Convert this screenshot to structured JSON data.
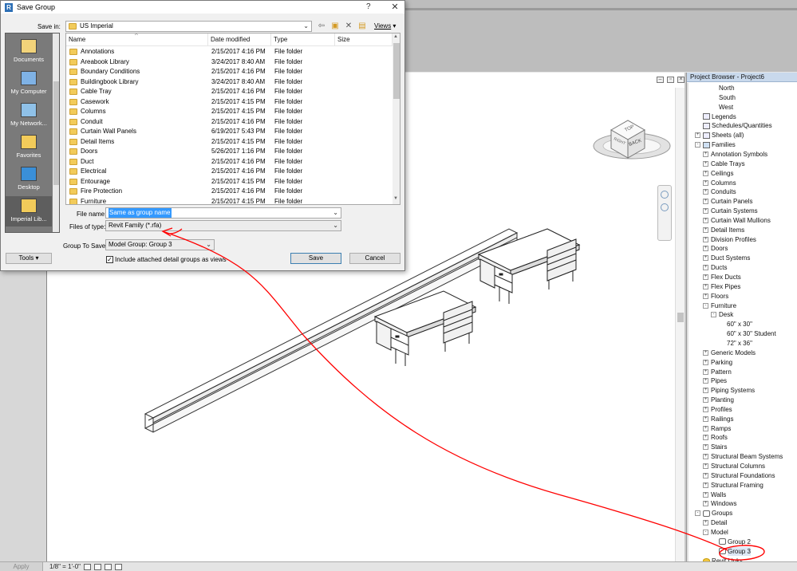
{
  "dialog": {
    "title": "Save Group",
    "app_icon": "R",
    "help_glyph": "?",
    "close_glyph": "✕",
    "save_in_label": "Save in:",
    "save_in_value": "US Imperial",
    "views_label": "Views",
    "columns": {
      "name": "Name",
      "date": "Date modified",
      "type": "Type",
      "size": "Size"
    },
    "files": [
      {
        "name": "Annotations",
        "date": "2/15/2017 4:16 PM",
        "type": "File folder"
      },
      {
        "name": "Areabook Library",
        "date": "3/24/2017 8:40 AM",
        "type": "File folder"
      },
      {
        "name": "Boundary Conditions",
        "date": "2/15/2017 4:16 PM",
        "type": "File folder"
      },
      {
        "name": "Buildingbook Library",
        "date": "3/24/2017 8:40 AM",
        "type": "File folder"
      },
      {
        "name": "Cable Tray",
        "date": "2/15/2017 4:16 PM",
        "type": "File folder"
      },
      {
        "name": "Casework",
        "date": "2/15/2017 4:15 PM",
        "type": "File folder"
      },
      {
        "name": "Columns",
        "date": "2/15/2017 4:15 PM",
        "type": "File folder"
      },
      {
        "name": "Conduit",
        "date": "2/15/2017 4:16 PM",
        "type": "File folder"
      },
      {
        "name": "Curtain Wall Panels",
        "date": "6/19/2017 5:43 PM",
        "type": "File folder"
      },
      {
        "name": "Detail Items",
        "date": "2/15/2017 4:15 PM",
        "type": "File folder"
      },
      {
        "name": "Doors",
        "date": "5/26/2017 1:16 PM",
        "type": "File folder"
      },
      {
        "name": "Duct",
        "date": "2/15/2017 4:16 PM",
        "type": "File folder"
      },
      {
        "name": "Electrical",
        "date": "2/15/2017 4:16 PM",
        "type": "File folder"
      },
      {
        "name": "Entourage",
        "date": "2/15/2017 4:15 PM",
        "type": "File folder"
      },
      {
        "name": "Fire Protection",
        "date": "2/15/2017 4:16 PM",
        "type": "File folder"
      },
      {
        "name": "Furniture",
        "date": "2/15/2017 4:15 PM",
        "type": "File folder"
      }
    ],
    "places": [
      {
        "label": "Documents"
      },
      {
        "label": "My Computer"
      },
      {
        "label": "My Network..."
      },
      {
        "label": "Favorites"
      },
      {
        "label": "Desktop"
      },
      {
        "label": "Imperial Lib..."
      }
    ],
    "file_name_label": "File name:",
    "file_name_value": "Same as group name",
    "files_of_type_label": "Files of type:",
    "files_of_type_value": "Revit Family  (*.rfa)",
    "group_to_save_label": "Group To Save:",
    "group_to_save_value": "Model Group: Group 3",
    "include_detail_label": "Include attached detail groups as views",
    "include_detail_checked": true,
    "tools_label": "Tools",
    "save_label": "Save",
    "cancel_label": "Cancel"
  },
  "project_browser": {
    "title": "Project Browser - Project6",
    "items": [
      {
        "label": "North",
        "indent": 3,
        "icon": "none"
      },
      {
        "label": "South",
        "indent": 3,
        "icon": "none"
      },
      {
        "label": "West",
        "indent": 3,
        "icon": "none"
      },
      {
        "label": "Legends",
        "indent": 1,
        "icon": "legend-icon"
      },
      {
        "label": "Schedules/Quantities",
        "indent": 1,
        "icon": "schedule-icon"
      },
      {
        "label": "Sheets (all)",
        "indent": 1,
        "icon": "sheet-icon",
        "expander": "+"
      },
      {
        "label": "Families",
        "indent": 1,
        "icon": "families-icon",
        "expander": "-"
      },
      {
        "label": "Annotation Symbols",
        "indent": 2,
        "icon": "none",
        "expander": "+"
      },
      {
        "label": "Cable Trays",
        "indent": 2,
        "icon": "none",
        "expander": "+"
      },
      {
        "label": "Ceilings",
        "indent": 2,
        "icon": "none",
        "expander": "+"
      },
      {
        "label": "Columns",
        "indent": 2,
        "icon": "none",
        "expander": "+"
      },
      {
        "label": "Conduits",
        "indent": 2,
        "icon": "none",
        "expander": "+"
      },
      {
        "label": "Curtain Panels",
        "indent": 2,
        "icon": "none",
        "expander": "+"
      },
      {
        "label": "Curtain Systems",
        "indent": 2,
        "icon": "none",
        "expander": "+"
      },
      {
        "label": "Curtain Wall Mullions",
        "indent": 2,
        "icon": "none",
        "expander": "+"
      },
      {
        "label": "Detail Items",
        "indent": 2,
        "icon": "none",
        "expander": "+"
      },
      {
        "label": "Division Profiles",
        "indent": 2,
        "icon": "none",
        "expander": "+"
      },
      {
        "label": "Doors",
        "indent": 2,
        "icon": "none",
        "expander": "+"
      },
      {
        "label": "Duct Systems",
        "indent": 2,
        "icon": "none",
        "expander": "+"
      },
      {
        "label": "Ducts",
        "indent": 2,
        "icon": "none",
        "expander": "+"
      },
      {
        "label": "Flex Ducts",
        "indent": 2,
        "icon": "none",
        "expander": "+"
      },
      {
        "label": "Flex Pipes",
        "indent": 2,
        "icon": "none",
        "expander": "+"
      },
      {
        "label": "Floors",
        "indent": 2,
        "icon": "none",
        "expander": "+"
      },
      {
        "label": "Furniture",
        "indent": 2,
        "icon": "none",
        "expander": "-"
      },
      {
        "label": "Desk",
        "indent": 3,
        "icon": "none",
        "expander": "-"
      },
      {
        "label": "60\" x 30\"",
        "indent": 4,
        "icon": "none"
      },
      {
        "label": "60\" x 30\" Student",
        "indent": 4,
        "icon": "none"
      },
      {
        "label": "72\" x 36\"",
        "indent": 4,
        "icon": "none"
      },
      {
        "label": "Generic Models",
        "indent": 2,
        "icon": "none",
        "expander": "+"
      },
      {
        "label": "Parking",
        "indent": 2,
        "icon": "none",
        "expander": "+"
      },
      {
        "label": "Pattern",
        "indent": 2,
        "icon": "none",
        "expander": "+"
      },
      {
        "label": "Pipes",
        "indent": 2,
        "icon": "none",
        "expander": "+"
      },
      {
        "label": "Piping Systems",
        "indent": 2,
        "icon": "none",
        "expander": "+"
      },
      {
        "label": "Planting",
        "indent": 2,
        "icon": "none",
        "expander": "+"
      },
      {
        "label": "Profiles",
        "indent": 2,
        "icon": "none",
        "expander": "+"
      },
      {
        "label": "Railings",
        "indent": 2,
        "icon": "none",
        "expander": "+"
      },
      {
        "label": "Ramps",
        "indent": 2,
        "icon": "none",
        "expander": "+"
      },
      {
        "label": "Roofs",
        "indent": 2,
        "icon": "none",
        "expander": "+"
      },
      {
        "label": "Stairs",
        "indent": 2,
        "icon": "none",
        "expander": "+"
      },
      {
        "label": "Structural Beam Systems",
        "indent": 2,
        "icon": "none",
        "expander": "+"
      },
      {
        "label": "Structural Columns",
        "indent": 2,
        "icon": "none",
        "expander": "+"
      },
      {
        "label": "Structural Foundations",
        "indent": 2,
        "icon": "none",
        "expander": "+"
      },
      {
        "label": "Structural Framing",
        "indent": 2,
        "icon": "none",
        "expander": "+"
      },
      {
        "label": "Walls",
        "indent": 2,
        "icon": "none",
        "expander": "+"
      },
      {
        "label": "Windows",
        "indent": 2,
        "icon": "none",
        "expander": "+"
      },
      {
        "label": "Groups",
        "indent": 1,
        "icon": "groups-icon",
        "expander": "-"
      },
      {
        "label": "Detail",
        "indent": 2,
        "icon": "none",
        "expander": "+"
      },
      {
        "label": "Model",
        "indent": 2,
        "icon": "none",
        "expander": "-"
      },
      {
        "label": "Group 2",
        "indent": 3,
        "icon": "group-icon"
      },
      {
        "label": "Group 3",
        "indent": 3,
        "icon": "group-icon",
        "selected": true
      },
      {
        "label": "Revit Links",
        "indent": 1,
        "icon": "link-icon"
      }
    ]
  },
  "viewcube": {
    "top_label": "TOP",
    "back_label": "BACK",
    "right_label": "RIGHT"
  },
  "status_bar": {
    "apply_label": "Apply",
    "scale": "1/8\" = 1'-0\""
  },
  "colors": {
    "annotation": "#ff0000",
    "selection": "#3399ff",
    "folder": "#f2cb5a"
  }
}
